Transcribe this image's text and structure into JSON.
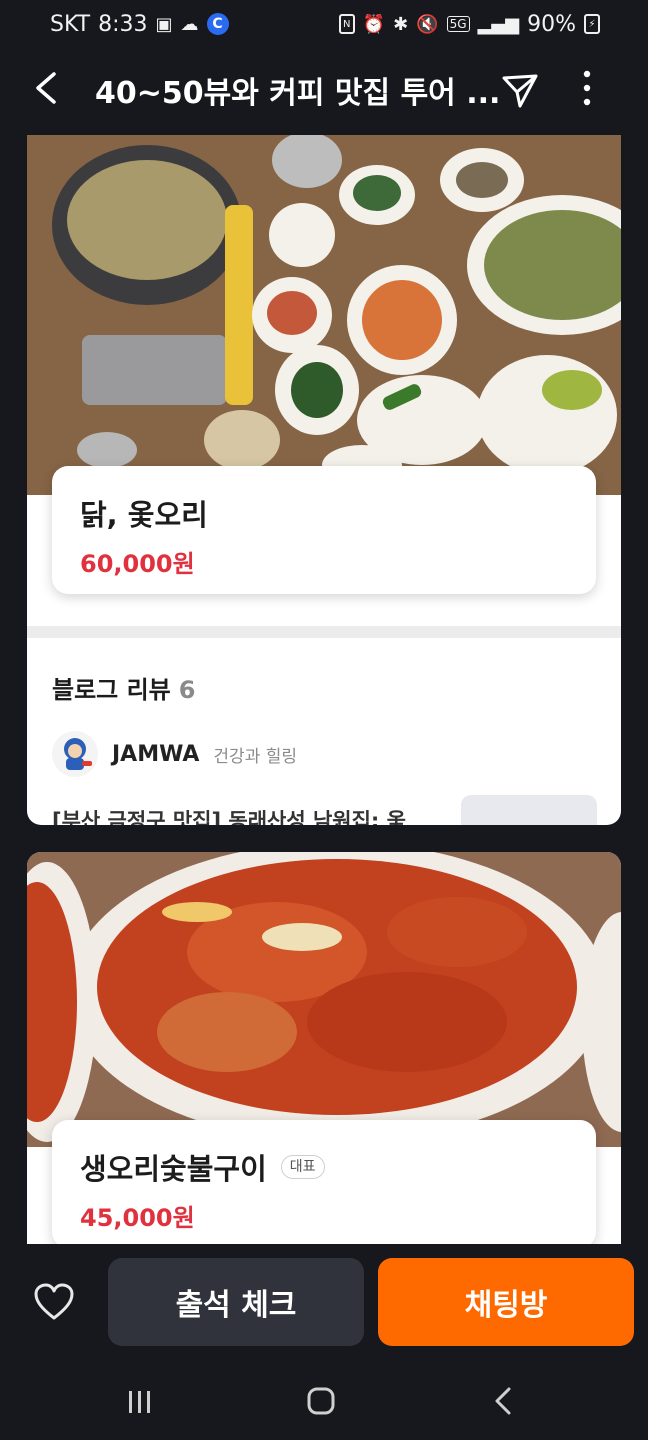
{
  "status_bar": {
    "carrier": "SKT",
    "time": "8:33",
    "network": "5G",
    "battery": "90%",
    "left_icons": [
      "gallery-icon",
      "weather-icon",
      "c-app-icon"
    ],
    "right_icons": [
      "nfc-icon",
      "alarm-icon",
      "bluetooth-icon",
      "mute-icon",
      "5g-icon",
      "signal-icon",
      "battery-icon"
    ]
  },
  "header": {
    "title": "40~50뷰와 커피 맛집 투어 ...",
    "icons": [
      "back-arrow-icon",
      "share-icon",
      "more-vertical-icon"
    ]
  },
  "menu_items": [
    {
      "name": "닭, 옻오리",
      "price": "60,000원",
      "badge": ""
    },
    {
      "name": "생오리숯불구이",
      "price": "45,000원",
      "badge": "대표"
    }
  ],
  "blog_review": {
    "title": "블로그 리뷰",
    "count": "6",
    "blogger_name": "JAMWA",
    "blogger_category": "건강과 힐링",
    "post_title": "[부산 금정구 맛집] 동래산성 남원집: 옻"
  },
  "bottom_bar": {
    "attendance_label": "출석 체크",
    "chat_label": "채팅방"
  },
  "colors": {
    "background": "#16181d",
    "chat_button": "#ff6a00",
    "attendance_button": "#30333b",
    "price": "#e0313e"
  }
}
